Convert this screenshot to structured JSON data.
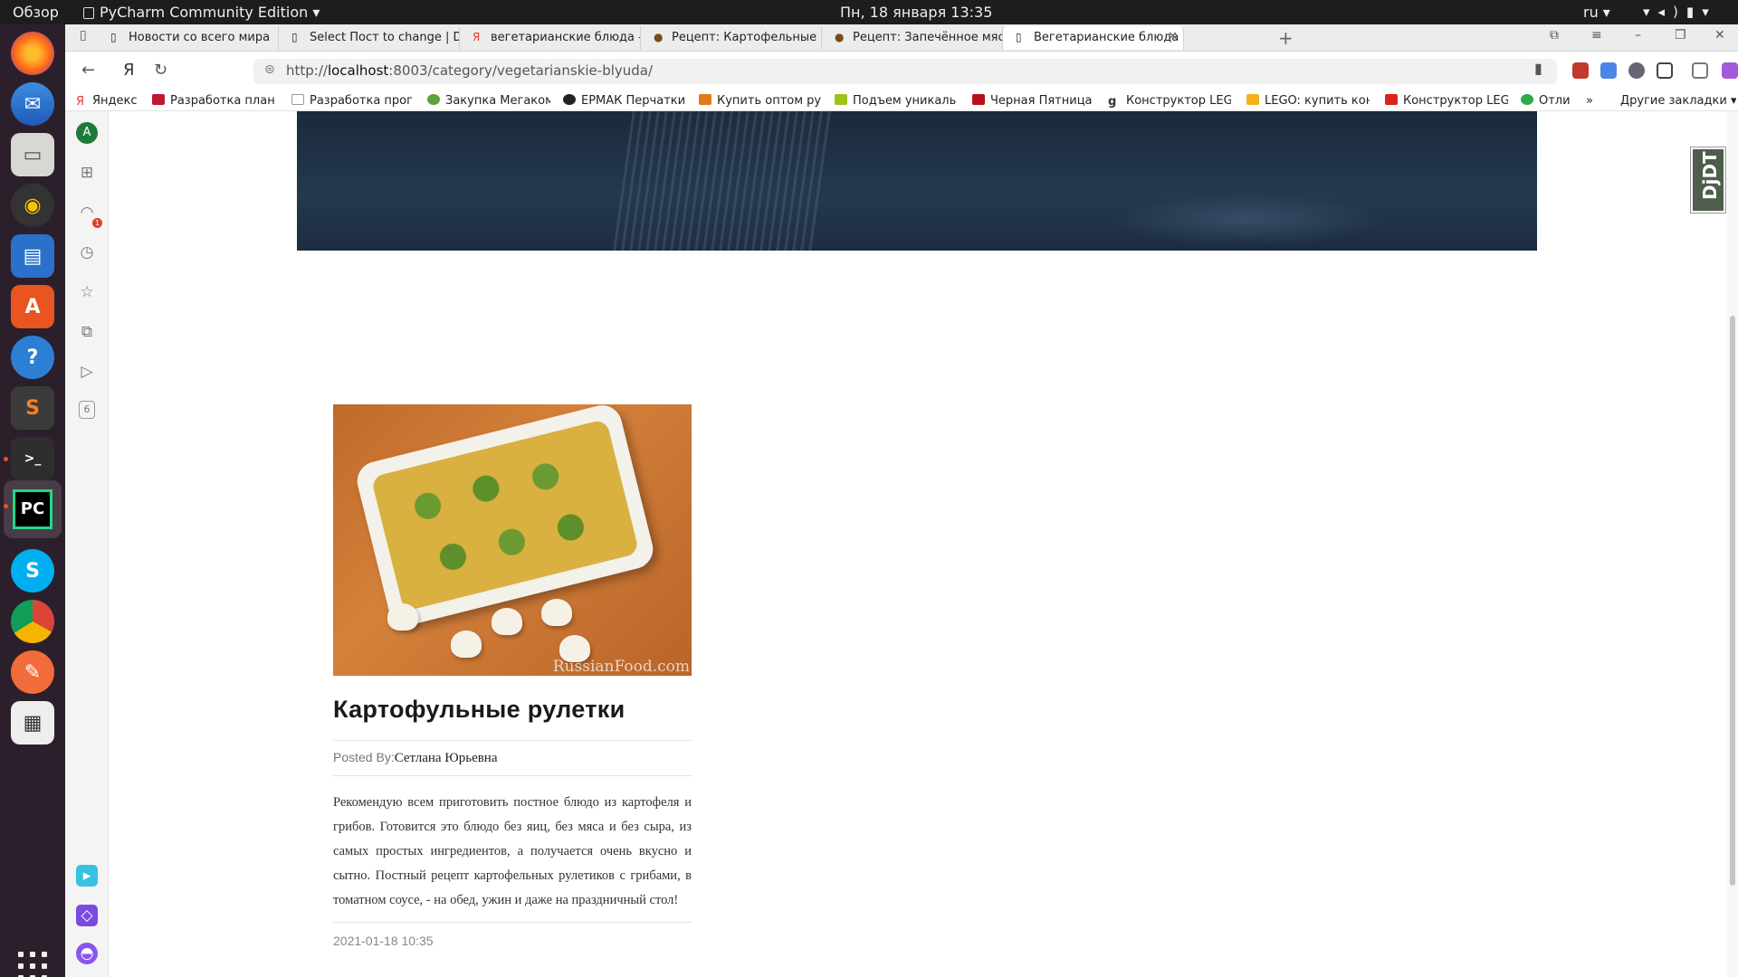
{
  "topbar": {
    "overview": "Обзор",
    "app": "PyCharm Community Edition ▾",
    "clock": "Пн, 18 января  13:35",
    "lang": "ru ▾",
    "sys": "▾ ◂) ▮ ▾"
  },
  "tabs": [
    {
      "title": "Новости со всего мира",
      "icon": "page-icon"
    },
    {
      "title": "Select Пост to change | Dja",
      "icon": "page-icon"
    },
    {
      "title": "вегетарианские блюда —",
      "icon": "yandex-icon"
    },
    {
      "title": "Рецепт: Картофельные ру",
      "icon": "pot-icon"
    },
    {
      "title": "Рецепт: Запечённое мясо",
      "icon": "pot-icon"
    },
    {
      "title": "Вегетарианские блюда",
      "icon": "page-icon",
      "active": true
    }
  ],
  "address": {
    "prefix": "http://",
    "host": "localhost",
    "rest": ":8003/category/vegetarianskie-blyuda/"
  },
  "bookmarks": [
    {
      "label": "Яндекс",
      "color": "#e03c31"
    },
    {
      "label": "Разработка план",
      "color": "#c0182e"
    },
    {
      "label": "Разработка прог",
      "color": "#999999"
    },
    {
      "label": "Закупка Мегаком",
      "color": "#5aa33a"
    },
    {
      "label": "ЕРМАК Перчатки",
      "color": "#222222"
    },
    {
      "label": "Купить оптом ру",
      "color": "#e07b1a"
    },
    {
      "label": "Подъем уникаль",
      "color": "#9bc31a"
    },
    {
      "label": "Черная Пятница",
      "color": "#b5121b"
    },
    {
      "label": "Конструктор LEG",
      "color": "#333333"
    },
    {
      "label": "LEGO: купить кон",
      "color": "#f2b21c"
    },
    {
      "label": "Конструктор LEG",
      "color": "#d9231d"
    },
    {
      "label": "Отли",
      "color": "#2fa94a"
    }
  ],
  "bookmarks_more": "»",
  "bookmarks_other": "Другие закладки ▾",
  "sidebar": {
    "avatar_letter": "A",
    "badge_count": "1",
    "counter": "6"
  },
  "djdt": "DjDT",
  "post": {
    "title": "Картофульные рулетки",
    "posted_by_label": "Posted By:",
    "author": "Сетлана Юрьевна",
    "text": "Рекомендую всем приготовить постное блюдо из картофеля и грибов. Готовится это блюдо без яиц, без мяса и без сыра, из самых простых ингредиентов, а получается очень вкусно и сытно. Постный рецепт картофельных рулетиков с грибами, в томатном соусе, - на обед, ужин и даже на праздничный стол!",
    "date": "2021-01-18 10:35",
    "image_watermark": "RussianFood.com"
  }
}
